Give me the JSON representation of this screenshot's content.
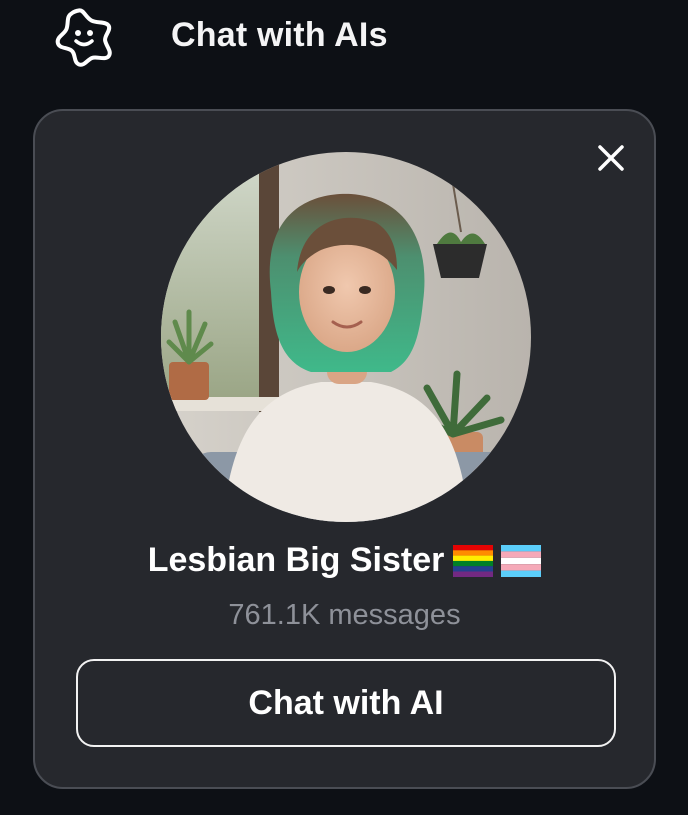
{
  "header": {
    "title": "Chat with AIs",
    "logo_icon": "sparkle-smiley-logo"
  },
  "card": {
    "close_icon": "close-icon",
    "avatar_alt": "profile-avatar",
    "name": "Lesbian Big Sister",
    "flags": [
      "rainbow-pride-flag-icon",
      "transgender-flag-icon"
    ],
    "messages": "761.1K messages",
    "cta_label": "Chat with AI"
  },
  "colors": {
    "background": "#0d1015",
    "card": "#26282d",
    "card_border": "#4a4d54",
    "muted_text": "#8e9199",
    "hair_accent": "#3fb98a"
  }
}
